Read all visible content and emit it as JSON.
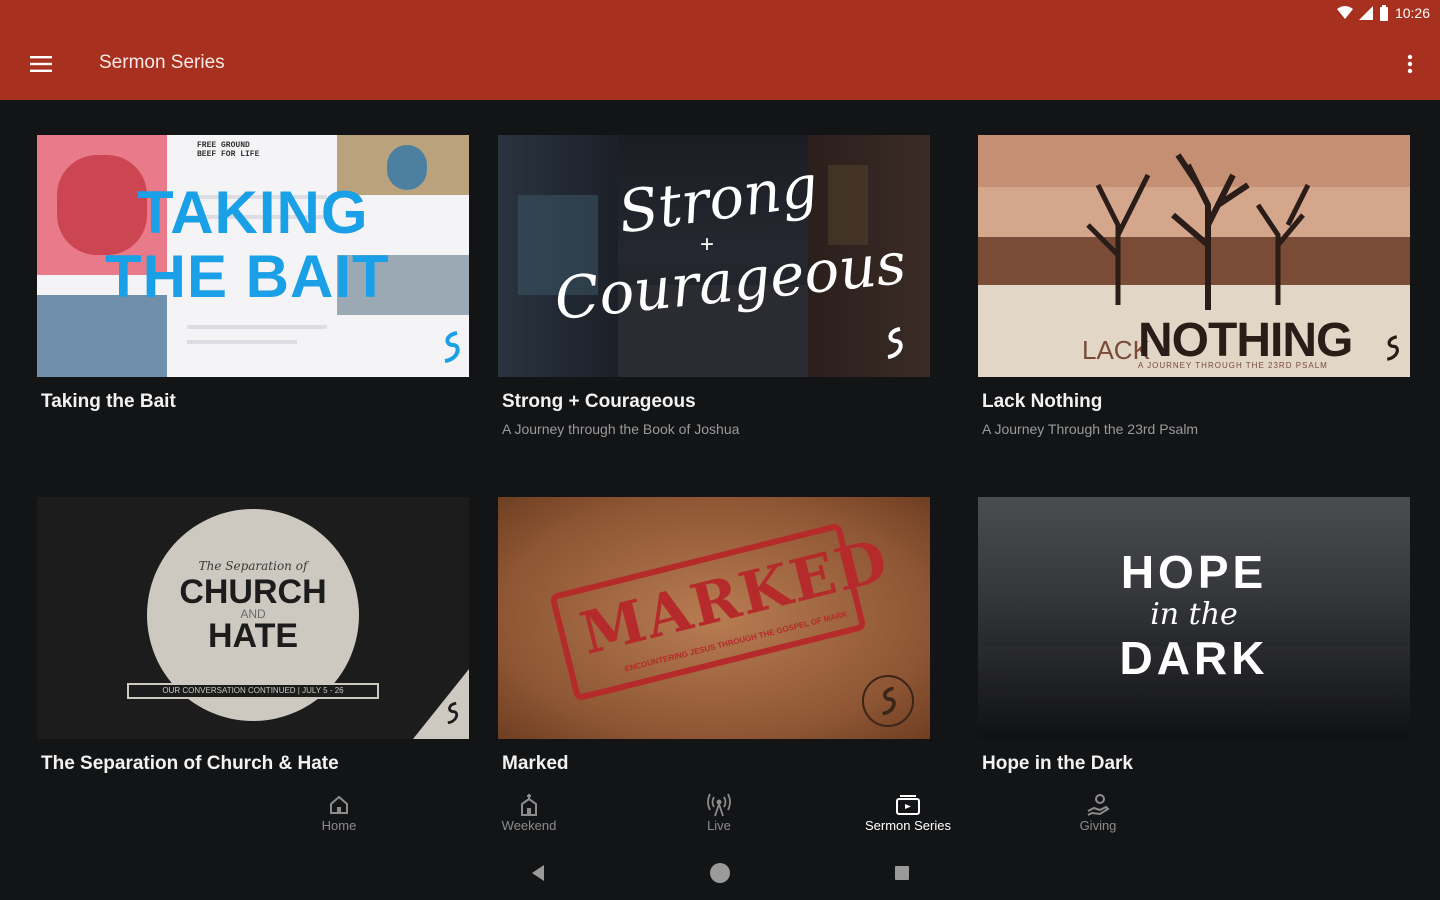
{
  "status": {
    "time": "10:26"
  },
  "app_bar": {
    "title": "Sermon Series",
    "menu_icon": "hamburger-menu-icon",
    "overflow_icon": "more-vert-icon"
  },
  "cards": [
    {
      "title": "Taking the Bait",
      "subtitle": "",
      "art_lines": [
        "FREE GROUND",
        "BEEF FOR LIFE"
      ],
      "art_title_1": "TAKING",
      "art_title_2": "THE BAIT"
    },
    {
      "title": "Strong + Courageous",
      "subtitle": "A Journey through the Book of Joshua",
      "art_line_1": "Strong",
      "art_line_2": "+",
      "art_line_3": "Courageous"
    },
    {
      "title": "Lack Nothing",
      "subtitle": "A Journey Through the 23rd Psalm",
      "art_small": "LACK",
      "art_big": "NOTHING",
      "art_tagline": "A JOURNEY THROUGH THE 23RD PSALM"
    },
    {
      "title": "The Separation of Church & Hate",
      "subtitle": "",
      "art_top": "The Separation of",
      "art_church": "CHURCH",
      "art_and": "AND",
      "art_hate": "HATE",
      "art_banner": "OUR CONVERSATION CONTINUED | JULY 5 - 26"
    },
    {
      "title": "Marked",
      "subtitle": "",
      "art_stamp": "MARKED",
      "art_stamp_sub": "ENCOUNTERING JESUS THROUGH THE GOSPEL OF MARK"
    },
    {
      "title": "Hope in the Dark",
      "subtitle": "",
      "art_hope": "HOPE",
      "art_in_the": "in the",
      "art_dark": "DARK"
    }
  ],
  "bottom_nav": [
    {
      "label": "Home",
      "icon": "home-icon",
      "active": false
    },
    {
      "label": "Weekend",
      "icon": "church-icon",
      "active": false
    },
    {
      "label": "Live",
      "icon": "broadcast-icon",
      "active": false
    },
    {
      "label": "Sermon Series",
      "icon": "series-icon",
      "active": true
    },
    {
      "label": "Giving",
      "icon": "giving-icon",
      "active": false
    }
  ],
  "colors": {
    "app_bar": "#a8301f",
    "background": "#131416",
    "active_nav": "#ffffff",
    "inactive_nav": "#8c8c8c"
  }
}
